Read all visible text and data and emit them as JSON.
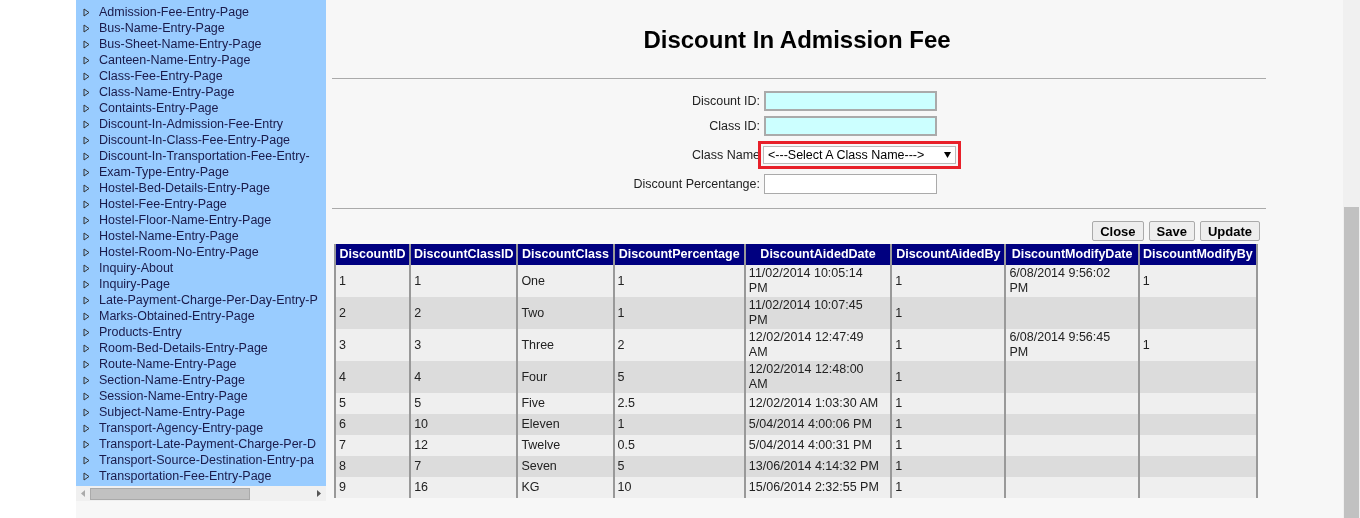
{
  "sidebar": {
    "items": [
      "Admission-Fee-Entry-Page",
      "Bus-Name-Entry-Page",
      "Bus-Sheet-Name-Entry-Page",
      "Canteen-Name-Entry-Page",
      "Class-Fee-Entry-Page",
      "Class-Name-Entry-Page",
      "Containts-Entry-Page",
      "Discount-In-Admission-Fee-Entry",
      "Discount-In-Class-Fee-Entry-Page",
      "Discount-In-Transportation-Fee-Entry-",
      "Exam-Type-Entry-Page",
      "Hostel-Bed-Details-Entry-Page",
      "Hostel-Fee-Entry-Page",
      "Hostel-Floor-Name-Entry-Page",
      "Hostel-Name-Entry-Page",
      "Hostel-Room-No-Entry-Page",
      "Inquiry-About",
      "Inquiry-Page",
      "Late-Payment-Charge-Per-Day-Entry-P",
      "Marks-Obtained-Entry-Page",
      "Products-Entry",
      "Room-Bed-Details-Entry-Page",
      "Route-Name-Entry-Page",
      "Section-Name-Entry-Page",
      "Session-Name-Entry-Page",
      "Subject-Name-Entry-Page",
      "Transport-Agency-Entry-page",
      "Transport-Late-Payment-Charge-Per-D",
      "Transport-Source-Destination-Entry-pa",
      "Transportation-Fee-Entry-Page"
    ]
  },
  "title": "Discount In Admission Fee",
  "form": [
    {
      "kind": "text",
      "label": "Discount ID:",
      "highlighted": true
    },
    {
      "kind": "text",
      "label": "Class ID:",
      "highlighted": true
    },
    {
      "kind": "select",
      "label": "Class Name",
      "value": "<---Select A Class Name--->",
      "highlighted": true
    },
    {
      "kind": "text",
      "label": "Discount Percentange:",
      "highlighted": false
    }
  ],
  "buttons": [
    "Close",
    "Save",
    "Update"
  ],
  "table": {
    "columns": [
      "DiscountID",
      "DiscountClassID",
      "DiscountClass",
      "DiscountPercentage",
      "DiscountAidedDate",
      "DiscountAidedBy",
      "DiscountModifyDate",
      "DiscountModifyBy"
    ],
    "rows": [
      {
        "cells": [
          "1",
          "1",
          "One",
          "1",
          "11/02/2014 10:05:14 PM",
          "1",
          "6/08/2014 9:56:02 PM",
          "1"
        ]
      },
      {
        "cells": [
          "2",
          "2",
          "Two",
          "1",
          "11/02/2014 10:07:45 PM",
          "1",
          null,
          null
        ]
      },
      {
        "cells": [
          "3",
          "3",
          "Three",
          "2",
          "12/02/2014 12:47:49 AM",
          "1",
          "6/08/2014 9:56:45 PM",
          "1"
        ]
      },
      {
        "cells": [
          "4",
          "4",
          "Four",
          "5",
          "12/02/2014 12:48:00 AM",
          "1",
          null,
          null
        ]
      },
      {
        "cells": [
          "5",
          "5",
          "Five",
          "2.5",
          "12/02/2014 1:03:30 AM",
          "1",
          null,
          null
        ]
      },
      {
        "cells": [
          "6",
          "10",
          "Eleven",
          "1",
          "5/04/2014 4:00:06 PM",
          "1",
          null,
          null
        ]
      },
      {
        "cells": [
          "7",
          "12",
          "Twelve",
          "0.5",
          "5/04/2014 4:00:31 PM",
          "1",
          null,
          null
        ]
      },
      {
        "cells": [
          "8",
          "7",
          "Seven",
          "5",
          "13/06/2014 4:14:32 PM",
          "1",
          null,
          null
        ]
      },
      {
        "cells": [
          "9",
          "16",
          "KG",
          "10",
          "15/06/2014 2:32:55 PM",
          "1",
          null,
          null
        ]
      }
    ]
  }
}
